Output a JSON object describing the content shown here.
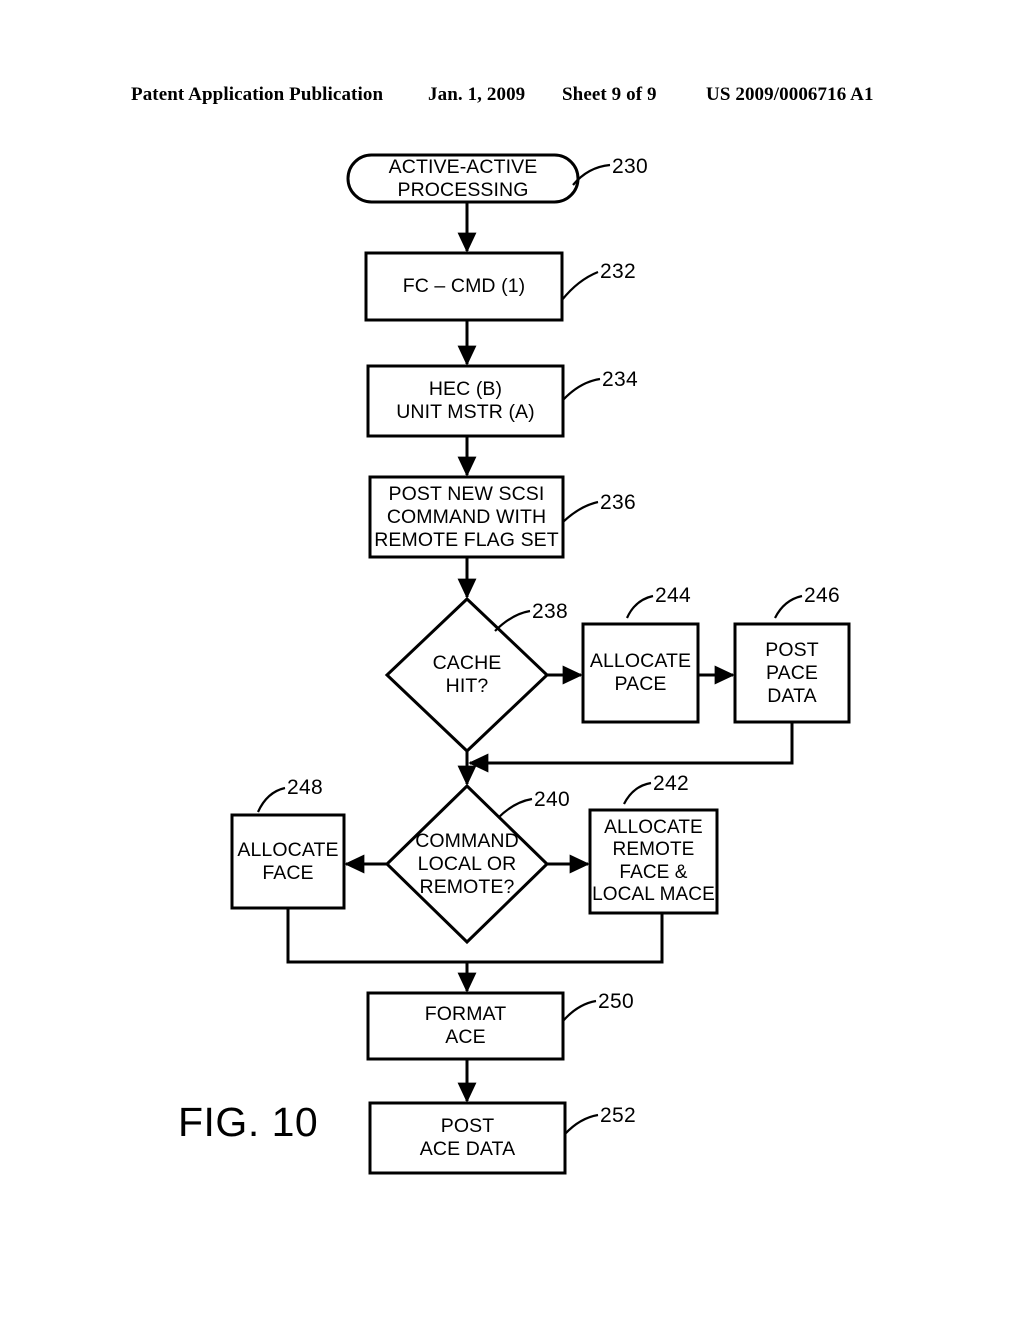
{
  "header": {
    "publication": "Patent Application Publication",
    "date": "Jan. 1, 2009",
    "sheet": "Sheet 9 of 9",
    "doc_id": "US 2009/0006716 A1"
  },
  "figure": {
    "label": "FIG. 10",
    "title": "ACTIVE-ACTIVE PROCESSING flowchart"
  },
  "nodes": {
    "n230": {
      "ref": "230",
      "shape": "terminator",
      "line1": "ACTIVE-ACTIVE",
      "line2": "PROCESSING"
    },
    "n232": {
      "ref": "232",
      "shape": "process",
      "line1": "FC – CMD (1)"
    },
    "n234": {
      "ref": "234",
      "shape": "process",
      "line1": "HEC (B)",
      "line2": "UNIT MSTR (A)"
    },
    "n236": {
      "ref": "236",
      "shape": "process",
      "line1": "POST NEW SCSI",
      "line2": "COMMAND WITH",
      "line3": "REMOTE FLAG SET"
    },
    "n238": {
      "ref": "238",
      "shape": "decision",
      "line1": "CACHE",
      "line2": "HIT?"
    },
    "n244": {
      "ref": "244",
      "shape": "process",
      "line1": "ALLOCATE",
      "line2": "PACE"
    },
    "n246": {
      "ref": "246",
      "shape": "process",
      "line1": "POST",
      "line2": "PACE",
      "line3": "DATA"
    },
    "n240": {
      "ref": "240",
      "shape": "decision",
      "line1": "COMMAND",
      "line2": "LOCAL OR",
      "line3": "REMOTE?"
    },
    "n248": {
      "ref": "248",
      "shape": "process",
      "line1": "ALLOCATE",
      "line2": "FACE"
    },
    "n242": {
      "ref": "242",
      "shape": "process",
      "line1": "ALLOCATE",
      "line2": "REMOTE",
      "line3": "FACE &",
      "line4": "LOCAL MACE"
    },
    "n250": {
      "ref": "250",
      "shape": "process",
      "line1": "FORMAT",
      "line2": "ACE"
    },
    "n252": {
      "ref": "252",
      "shape": "process",
      "line1": "POST",
      "line2": "ACE DATA"
    }
  },
  "colors": {
    "ink": "#000000",
    "paper": "#ffffff"
  }
}
